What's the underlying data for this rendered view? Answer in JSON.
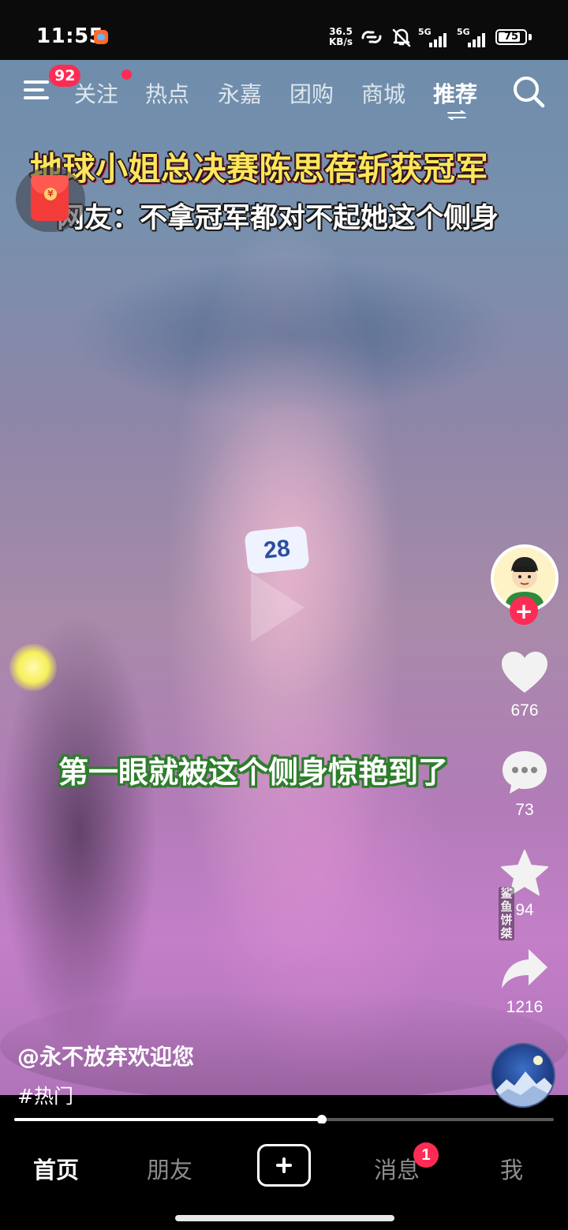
{
  "status_bar": {
    "time": "11:55",
    "net_speed_value": "36.5",
    "net_speed_unit": "KB/s",
    "sim1_label": "5G",
    "sim2_label": "5G",
    "battery_level": "75"
  },
  "top_nav": {
    "menu_badge": "92",
    "tabs": [
      {
        "label": "关注",
        "has_dot": true
      },
      {
        "label": "热点"
      },
      {
        "label": "永嘉"
      },
      {
        "label": "团购"
      },
      {
        "label": "商城"
      },
      {
        "label": "推荐",
        "active": true
      }
    ]
  },
  "video": {
    "caption_title": "地球小姐总决赛陈思蓓斩获冠军",
    "caption_subtitle": "网友：不拿冠军都对不起她这个侧身",
    "caption_mid": "第一眼就被这个侧身惊艳到了",
    "bib_number": "28",
    "vertical_watermark": "鲨鱼饼桀"
  },
  "actions": {
    "likes": "676",
    "comments": "73",
    "favorites": "94",
    "shares": "1216"
  },
  "post": {
    "author": "@永不放弃欢迎您",
    "hashtag": "#热门"
  },
  "playback": {
    "progress_fraction": 0.57
  },
  "bottom_tabs": {
    "home": "首页",
    "friends": "朋友",
    "messages": "消息",
    "messages_badge": "1",
    "me": "我"
  },
  "colors": {
    "accent": "#fe2c55",
    "caption_title": "#fde65a",
    "caption_mid_outline": "#2e7d2c"
  }
}
